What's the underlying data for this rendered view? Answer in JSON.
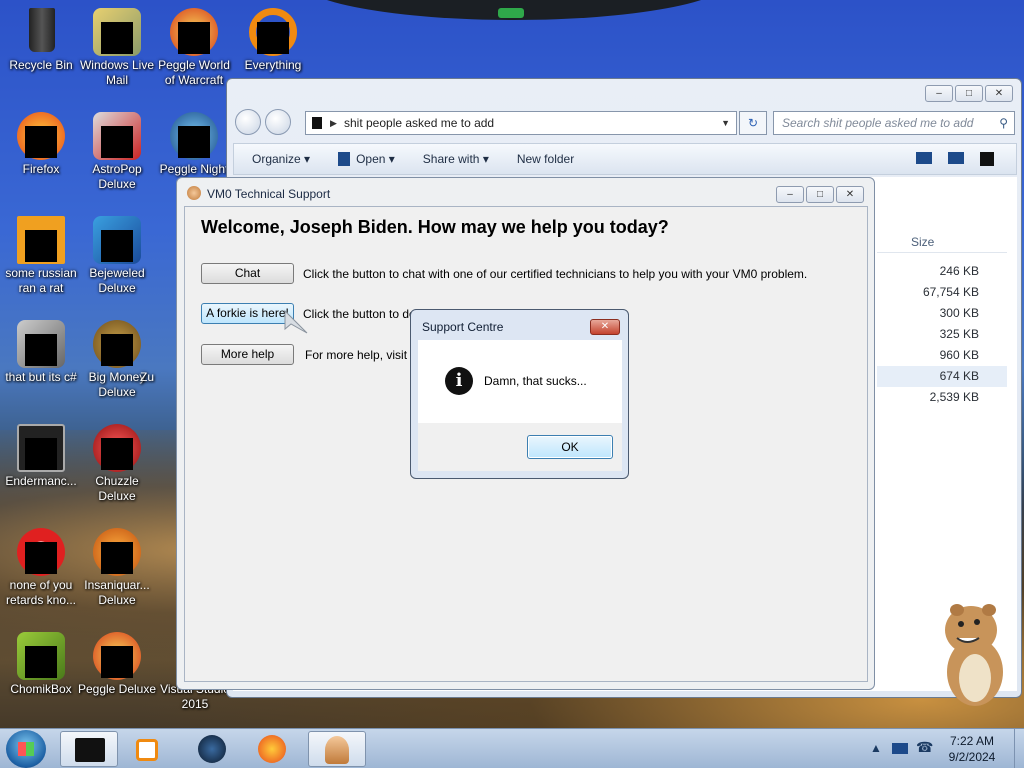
{
  "desktop": {
    "icons": [
      {
        "label": "Recycle Bin"
      },
      {
        "label": "Windows Live Mail"
      },
      {
        "label": "Peggle World of Warcraft"
      },
      {
        "label": "Everything"
      },
      {
        "label": "Firefox"
      },
      {
        "label": "AstroPop Deluxe"
      },
      {
        "label": "Peggle Night"
      },
      {
        "label": "some russian ran a rat"
      },
      {
        "label": "Bejeweled Deluxe"
      },
      {
        "label": "that but its c#"
      },
      {
        "label": "Big Money Deluxe"
      },
      {
        "label": "Zu"
      },
      {
        "label": "Endermanc..."
      },
      {
        "label": "Chuzzle Deluxe"
      },
      {
        "label": "none of you retards kno..."
      },
      {
        "label": "Insaniquar... Deluxe"
      },
      {
        "label": "ChomikBox"
      },
      {
        "label": "Peggle Deluxe"
      },
      {
        "label": "Visual Studio 2015"
      }
    ]
  },
  "explorer": {
    "address": "shit people asked me to add",
    "search_placeholder": "Search shit people asked me to add",
    "commands": {
      "organize": "Organize",
      "open": "Open",
      "share_with": "Share with",
      "new_folder": "New folder"
    },
    "column_size": "Size",
    "sizes": [
      "246 KB",
      "67,754 KB",
      "300 KB",
      "325 KB",
      "960 KB",
      "674 KB",
      "2,539 KB"
    ]
  },
  "tech_support": {
    "title": "VM0 Technical Support",
    "welcome": "Welcome, Joseph Biden. How may we help you today?",
    "chat_button": "Chat",
    "chat_desc": "Click the button to chat with one of our certified technicians to help you with your VM0 problem.",
    "forkie_button": "A forkie is here!",
    "forkie_desc": "Click the button to dela",
    "more_help_button": "More help",
    "more_help_desc": "For more help, visit our"
  },
  "dialog": {
    "title": "Support Centre",
    "message": "Damn, that sucks...",
    "ok": "OK"
  },
  "taskbar": {
    "time": "7:22 AM",
    "date": "9/2/2024"
  },
  "colors": {
    "accent": "#3c7fb1",
    "close_red": "#c4432e"
  }
}
